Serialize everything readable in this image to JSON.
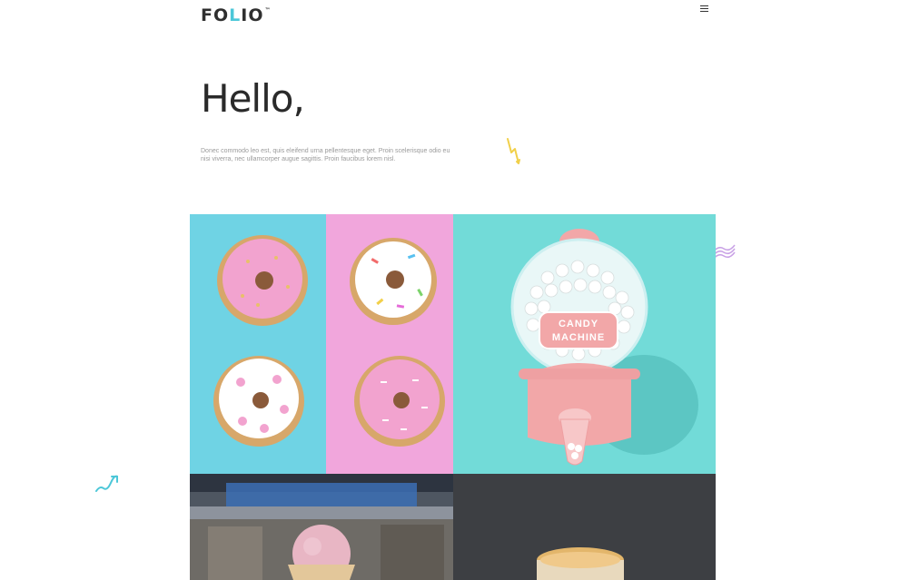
{
  "header": {
    "logo": {
      "part1": "FO",
      "part2": "L",
      "part3": "IO",
      "mark": "™"
    },
    "menu_icon": "hamburger-menu-icon"
  },
  "hero": {
    "title": "Hello,",
    "text": "Donec commodo leo est, quis eleifend urna pellentesque eget. Proin scelerisque odio eu nisi viverra, nec ullamcorper augue sagittis. Proin faucibus lorem nisl."
  },
  "portfolio": {
    "items": [
      {
        "name": "donuts",
        "label": ""
      },
      {
        "name": "candy-machine",
        "label": "CANDY MACHINE",
        "label_line1": "CANDY",
        "label_line2": "MACHINE"
      },
      {
        "name": "ice-cream",
        "label": ""
      },
      {
        "name": "macaron",
        "label": ""
      }
    ]
  },
  "colors": {
    "accent_cyan": "#4cc7d8",
    "accent_yellow": "#f1d04a",
    "accent_purple": "#c9a2e6",
    "tile_blue": "#6fd3e4",
    "tile_pink": "#f1a6dc",
    "tile_teal": "#72dbd8"
  }
}
